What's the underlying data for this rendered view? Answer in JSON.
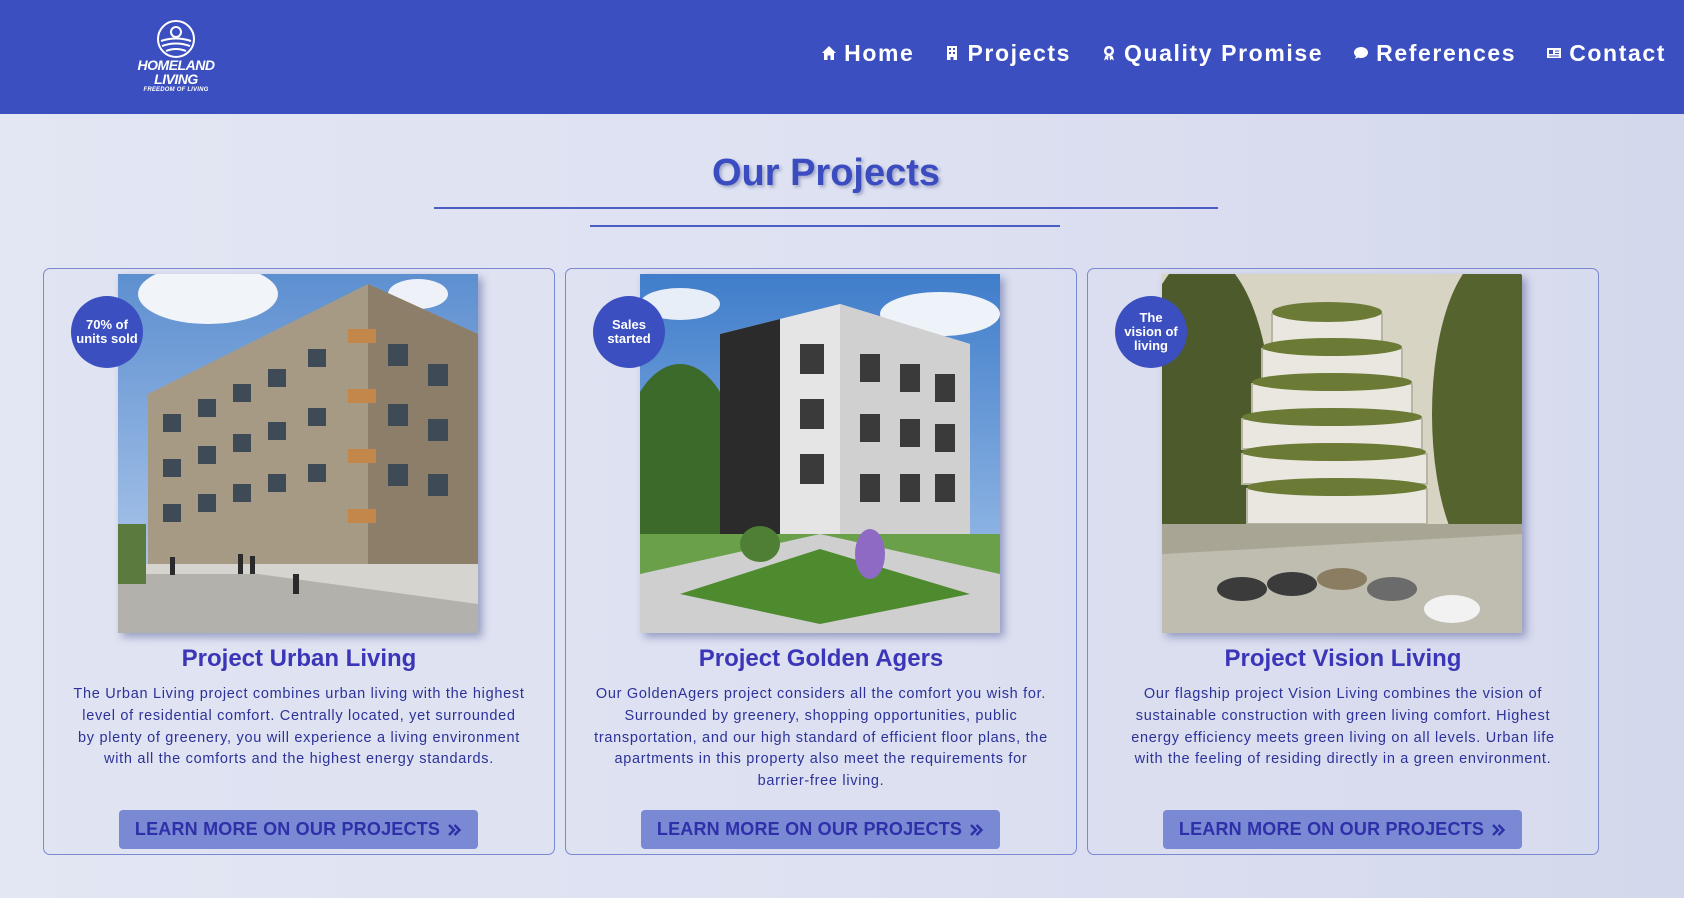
{
  "header": {
    "logo": {
      "name": "HOMELAND LIVING",
      "tagline": "FREEDOM OF LIVING"
    },
    "nav": [
      {
        "label": "Home",
        "icon": "home-icon"
      },
      {
        "label": "Projects",
        "icon": "building-icon"
      },
      {
        "label": "Quality Promise",
        "icon": "award-icon"
      },
      {
        "label": "References",
        "icon": "comment-icon"
      },
      {
        "label": "Contact",
        "icon": "contact-card-icon"
      }
    ]
  },
  "main": {
    "title": "Our Projects",
    "projects": [
      {
        "badge": "70% of units sold",
        "title": "Project Urban Living",
        "description": "The Urban Living project combines urban living with the highest level of residential comfort. Centrally located, yet surrounded by plenty of greenery, you will experience a living environment with all the comforts and the highest energy standards.",
        "button": "LEARN MORE ON OUR PROJECTS",
        "button_icon": "double-chevron-right-icon"
      },
      {
        "badge": "Sales started",
        "title": "Project Golden Agers",
        "description": "Our GoldenAgers project considers all the comfort you wish for. Surrounded by greenery, shopping opportunities, public transportation, and our high standard of efficient floor plans, the apartments in this property also meet the requirements for barrier-free living.",
        "button": "LEARN MORE ON OUR PROJECTS",
        "button_icon": "double-chevron-right-icon"
      },
      {
        "badge": "The vision of living",
        "title": "Project Vision Living",
        "description": "Our flagship project Vision Living combines the vision of sustainable construction with green living comfort. Highest energy efficiency meets green living on all levels. Urban life with the feeling of residing directly in a green environment.",
        "button": "LEARN MORE ON OUR PROJECTS",
        "button_icon": "double-chevron-right-icon"
      }
    ]
  },
  "colors": {
    "header_bg": "#3b4fc0",
    "accent": "#3a4cbf",
    "button_bg": "#7a89d3",
    "page_bg": "#dde1f1"
  }
}
